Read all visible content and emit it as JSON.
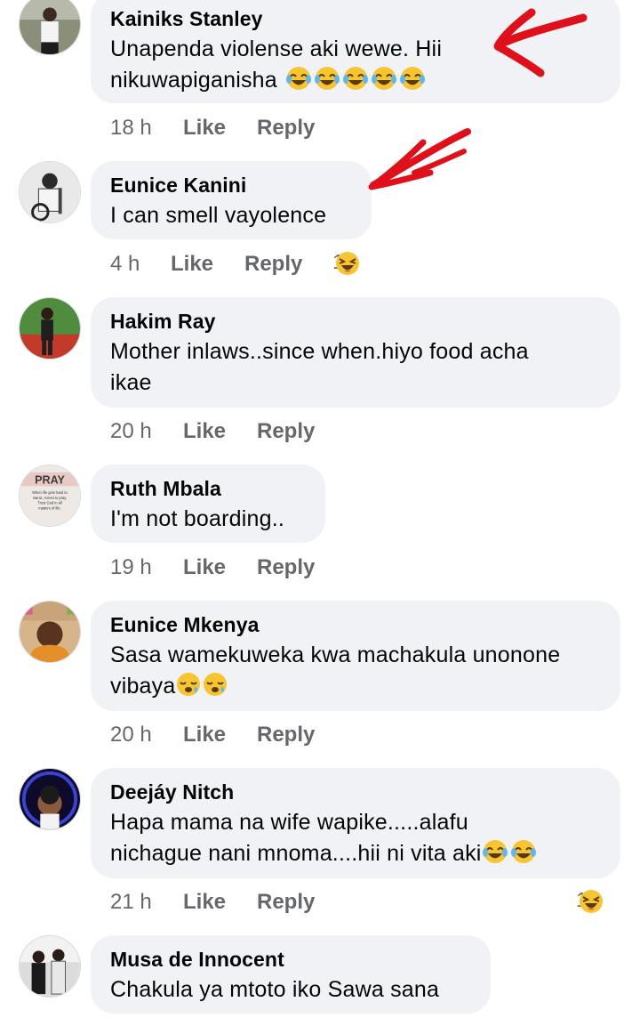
{
  "comments": [
    {
      "name": "Kainiks Stanley",
      "lines": [
        "Unapenda violense aki wewe. Hii",
        "nikuwapiganisha"
      ],
      "emoji_count": 5,
      "emoji": "laugh-cry-icon",
      "time": "18 h",
      "like": "Like",
      "reply": "Reply",
      "reaction_count": ""
    },
    {
      "name": "Eunice Kanini",
      "lines": [
        "I can smell vayolence"
      ],
      "time": "4 h",
      "like": "Like",
      "reply": "Reply",
      "reaction_count": "1",
      "reaction_icon": "haha-reaction-icon"
    },
    {
      "name": "Hakim Ray",
      "lines": [
        "Mother inlaws..since when.hiyo food acha",
        "ikae"
      ],
      "time": "20 h",
      "like": "Like",
      "reply": "Reply",
      "reaction_count": ""
    },
    {
      "name": "Ruth Mbala",
      "lines": [
        "I'm not boarding.."
      ],
      "time": "19 h",
      "like": "Like",
      "reply": "Reply",
      "reaction_count": "",
      "avatar_text": [
        "PRAY",
        "When life gets hard to",
        "stand...Kneel to pray.",
        "Trust God in all",
        "matters of life."
      ]
    },
    {
      "name": "Eunice Mkenya",
      "lines": [
        "Sasa wamekuweka kwa machakula unonone",
        "vibaya"
      ],
      "emoji_count": 2,
      "emoji": "sleepy-face-icon",
      "time": "20 h",
      "like": "Like",
      "reply": "Reply",
      "reaction_count": ""
    },
    {
      "name": "Deejáy Nitch",
      "lines": [
        "Hapa mama na wife wapike.....alafu",
        "nichague nani mnoma....hii ni vita aki"
      ],
      "emoji_count": 2,
      "emoji": "laugh-cry-icon",
      "time": "21 h",
      "like": "Like",
      "reply": "Reply",
      "reaction_count": "1",
      "reaction_icon": "haha-reaction-icon"
    },
    {
      "name": "Musa de Innocent",
      "lines": [
        "Chakula ya mtoto iko Sawa sana"
      ],
      "time": "",
      "like": "",
      "reply": "",
      "reaction_count": ""
    }
  ],
  "colors": {
    "bubble": "#f0f2f5",
    "meta_text": "#65676b",
    "annotation_arrow": "#e0101a"
  }
}
